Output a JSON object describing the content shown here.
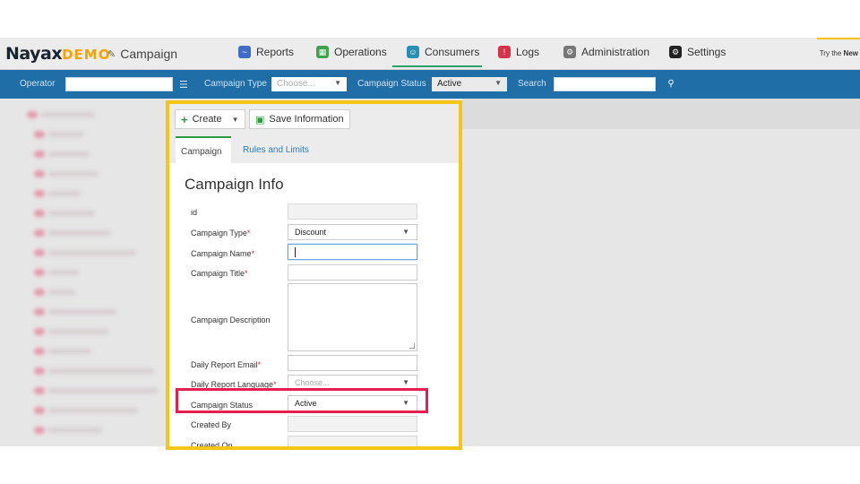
{
  "app": {
    "logo_main": "Nayax",
    "logo_demo": "DEMO",
    "page_title": "Campaign",
    "try_prefix": "Try the ",
    "try_bold": "New"
  },
  "nav": {
    "reports": "Reports",
    "operations": "Operations",
    "consumers": "Consumers",
    "logs": "Logs",
    "administration": "Administration",
    "settings": "Settings"
  },
  "filter": {
    "operator_label": "Operator",
    "campaign_type_label": "Campaign Type",
    "campaign_type_placeholder": "Choose...",
    "campaign_status_label": "Campaign Status",
    "campaign_status_value": "Active",
    "search_label": "Search"
  },
  "toolbar": {
    "create_label": "Create",
    "save_label": "Save Information"
  },
  "tabs": {
    "campaign": "Campaign",
    "rules": "Rules and Limits"
  },
  "form": {
    "title": "Campaign Info",
    "id_label": "id",
    "type_label": "Campaign Type",
    "type_value": "Discount",
    "name_label": "Campaign Name",
    "title_label": "Campaign Title",
    "description_label": "Campaign Description",
    "email_label": "Daily Report Email",
    "language_label": "Daily Report Language",
    "language_placeholder": "Choose...",
    "status_label": "Campaign Status",
    "status_value": "Active",
    "created_by_label": "Created By",
    "created_on_label": "Created On",
    "required_mark": "*"
  },
  "colors": {
    "filterbar": "#1f6ea7",
    "highlight_panel": "#f5c518",
    "highlight_status": "#e51e4e",
    "active_tab": "#2e9b3f"
  }
}
